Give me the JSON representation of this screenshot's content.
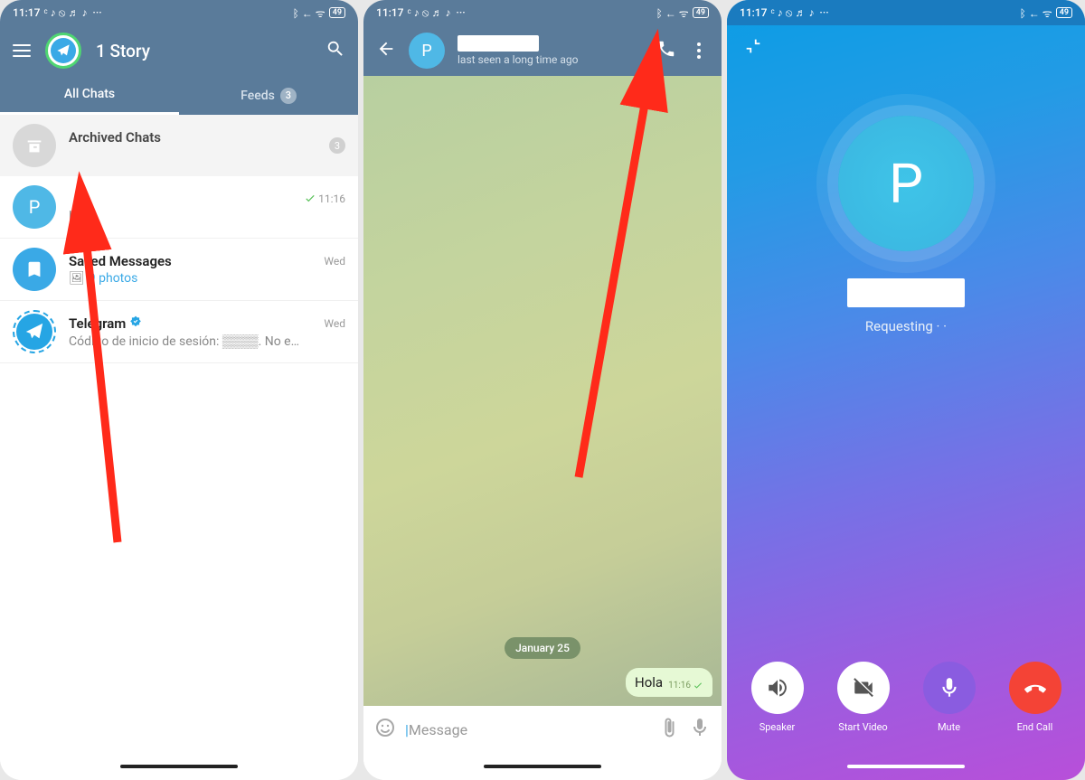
{
  "status": {
    "time": "11:17",
    "battery": "49",
    "icons": "✶ ← ᯤ"
  },
  "screen1": {
    "title": "1 Story",
    "tabs": {
      "all": "All Chats",
      "feeds": "Feeds",
      "feeds_badge": "3"
    },
    "archived": {
      "title": "Archived Chats",
      "badge": "3"
    },
    "chats": [
      {
        "avatar_letter": "P",
        "name": "",
        "msg": "Hola",
        "time": "11:16",
        "checked": true
      },
      {
        "avatar": "saved",
        "name": "Saved Messages",
        "msg_prefix": "🖼",
        "msg": "9 photos",
        "time": "Wed"
      },
      {
        "avatar": "tg",
        "name": "Telegram",
        "msg": "Código de inicio de sesión: ▒▒▒▒. No e…",
        "time": "Wed",
        "verified": true
      }
    ]
  },
  "screen2": {
    "status_line": "last seen a long time ago",
    "avatar_letter": "P",
    "date": "January 25",
    "bubble": {
      "text": "Hola",
      "time": "11:16"
    },
    "placeholder": "Message"
  },
  "screen3": {
    "avatar_letter": "P",
    "status": "Requesting · ·",
    "buttons": {
      "speaker": "Speaker",
      "video": "Start Video",
      "mute": "Mute",
      "end": "End Call"
    }
  }
}
